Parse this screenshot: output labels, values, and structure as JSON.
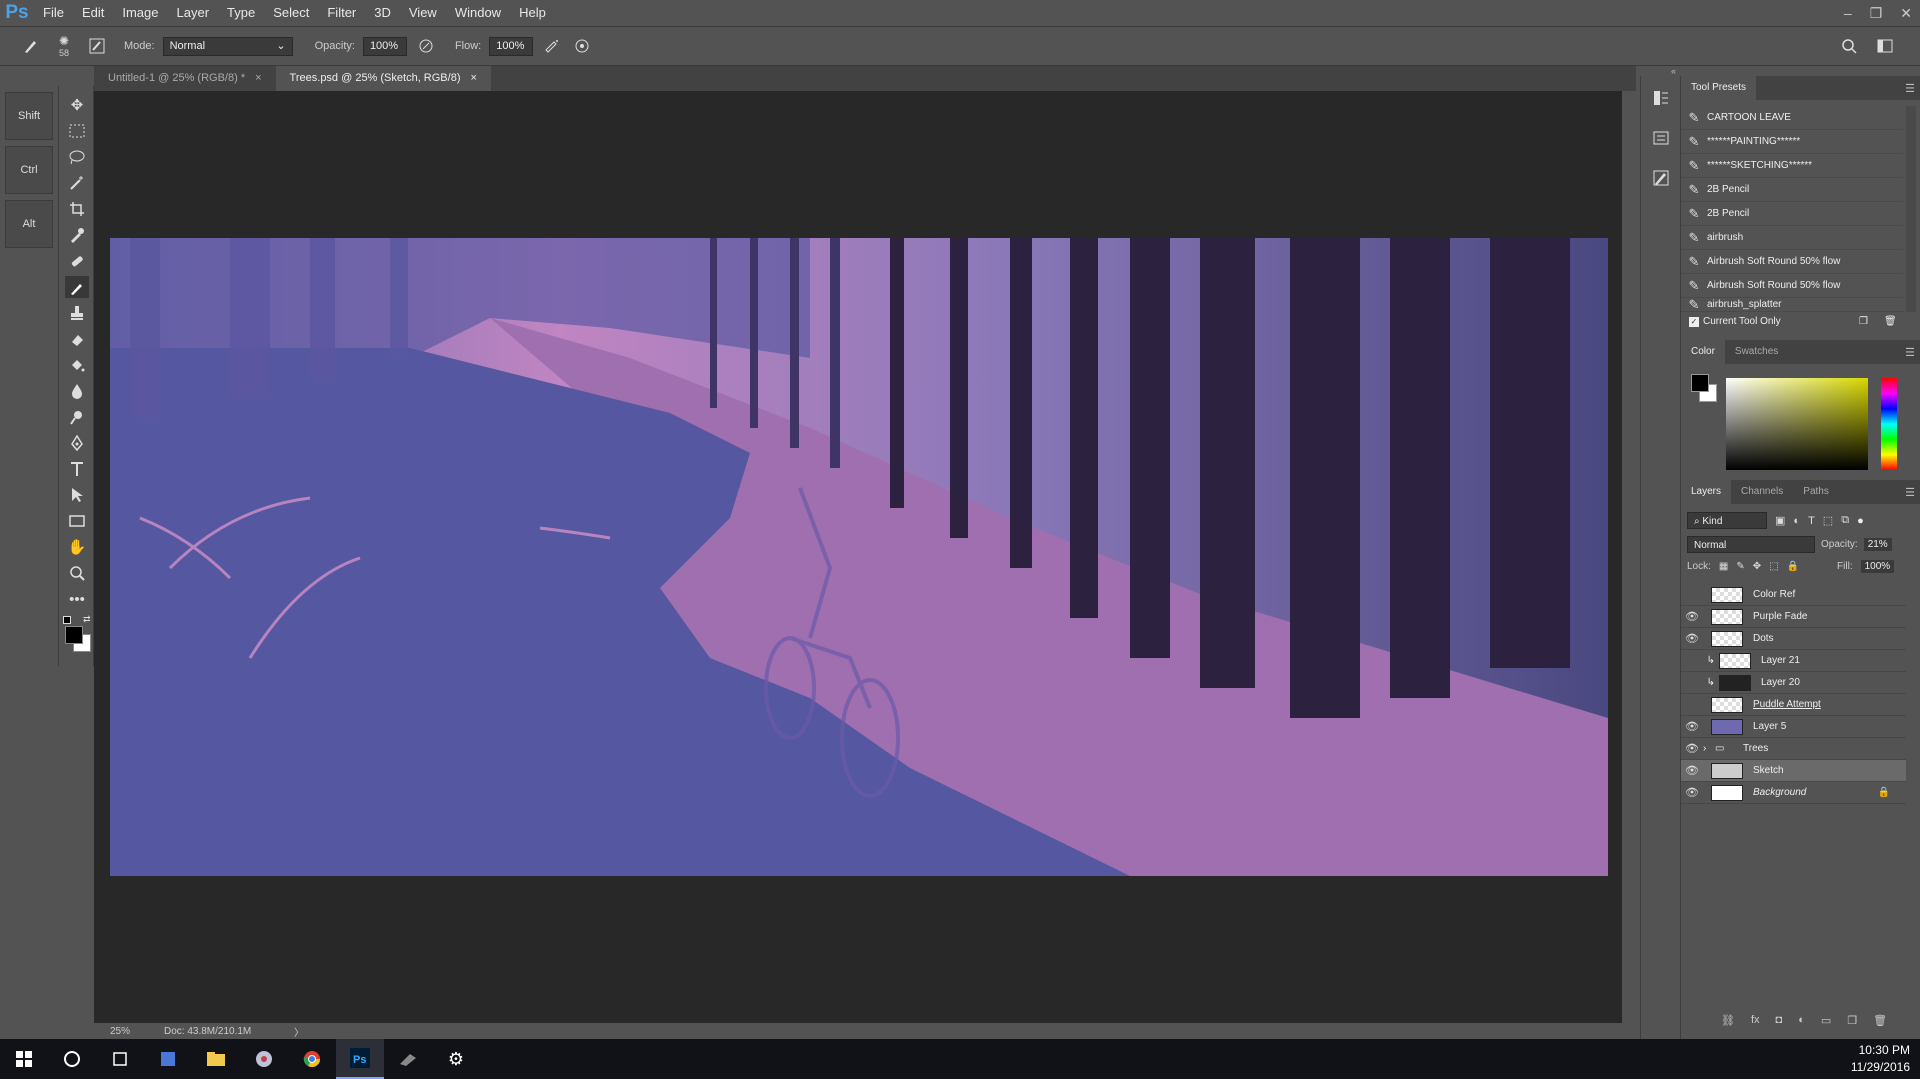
{
  "menubar": {
    "logo": "Ps",
    "items": [
      "File",
      "Edit",
      "Image",
      "Layer",
      "Type",
      "Select",
      "Filter",
      "3D",
      "View",
      "Window",
      "Help"
    ],
    "window_controls": [
      "–",
      "❐",
      "✕"
    ]
  },
  "options": {
    "brush_size": "58",
    "mode_label": "Mode:",
    "mode_value": "Normal",
    "opacity_label": "Opacity:",
    "opacity_value": "100%",
    "flow_label": "Flow:",
    "flow_value": "100%"
  },
  "modifier_keys": [
    "Shift",
    "Ctrl",
    "Alt"
  ],
  "tabs": [
    {
      "label": "Untitled-1 @ 25% (RGB/8) *",
      "close": "×"
    },
    {
      "label": "Trees.psd @ 25% (Sketch, RGB/8)",
      "close": "×"
    }
  ],
  "status": {
    "zoom": "25%",
    "doc": "Doc: 43.8M/210.1M",
    "arrow": "〉"
  },
  "tool_presets": {
    "title": "Tool Presets",
    "items": [
      "CARTOON LEAVE",
      "******PAINTING******",
      "******SKETCHING******",
      "2B Pencil",
      "2B Pencil",
      "airbrush",
      "Airbrush Soft Round 50% flow",
      "Airbrush Soft Round 50% flow",
      "airbrush_splatter"
    ],
    "current_tool_only": "Current Tool Only"
  },
  "color_panel": {
    "tabs": [
      "Color",
      "Swatches"
    ]
  },
  "layers_panel": {
    "tabs": [
      "Layers",
      "Channels",
      "Paths"
    ],
    "kind": "Kind",
    "blend_mode": "Normal",
    "opacity_label": "Opacity:",
    "opacity_value": "21%",
    "lock_label": "Lock:",
    "fill_label": "Fill:",
    "fill_value": "100%",
    "layers": [
      {
        "name": "Color Ref",
        "visible": false
      },
      {
        "name": "Purple Fade",
        "visible": true
      },
      {
        "name": "Dots",
        "visible": true
      },
      {
        "name": "Layer 21",
        "visible": false
      },
      {
        "name": "Layer 20",
        "visible": false
      },
      {
        "name": "Puddle Attempt",
        "visible": false
      },
      {
        "name": "Layer 5",
        "visible": true
      },
      {
        "name": "Trees",
        "visible": true
      },
      {
        "name": "Sketch",
        "visible": true
      },
      {
        "name": "Background",
        "visible": true
      }
    ]
  },
  "taskbar": {
    "time": "10:30 PM",
    "date": "11/29/2016"
  },
  "colors": {
    "foreground": "#000000",
    "background": "#ffffff",
    "road_purple": "#a06fb0",
    "shadow_blue": "#5558a0"
  }
}
